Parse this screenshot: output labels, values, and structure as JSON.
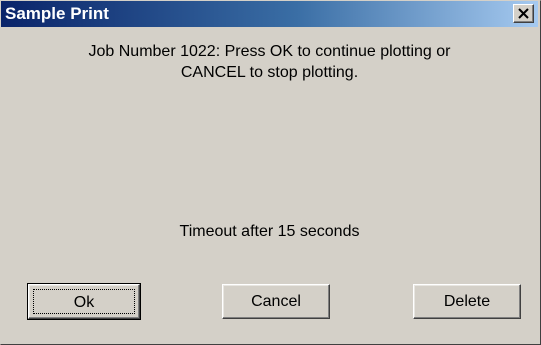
{
  "window": {
    "title": "Sample Print",
    "close_glyph": "close-icon"
  },
  "message": {
    "line1": "Job Number 1022: Press OK to continue plotting or",
    "line2": "CANCEL to stop plotting."
  },
  "timeout_text": "Timeout after 15 seconds",
  "buttons": {
    "ok": "Ok",
    "cancel": "Cancel",
    "delete": "Delete"
  },
  "colors": {
    "face": "#d4d0c8",
    "titlebar_start": "#0a246a",
    "titlebar_end": "#a6caf0"
  }
}
